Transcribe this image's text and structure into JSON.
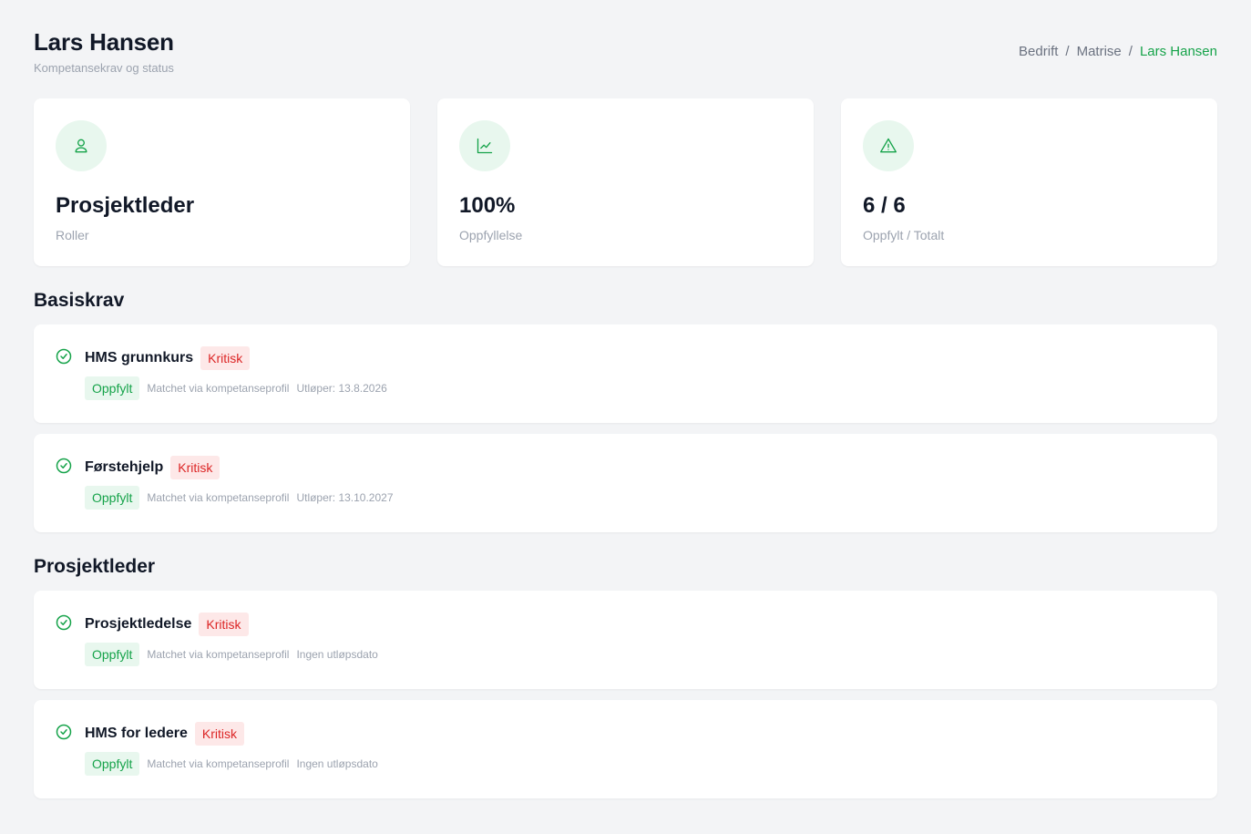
{
  "header": {
    "title": "Lars Hansen",
    "subtitle": "Kompetansekrav og status",
    "breadcrumb": [
      "Bedrift",
      "Matrise",
      "Lars Hansen"
    ],
    "breadcrumb_separator": "/"
  },
  "stats": [
    {
      "icon": "user-icon",
      "value": "Prosjektleder",
      "label": "Roller"
    },
    {
      "icon": "chart-line-icon",
      "value": "100%",
      "label": "Oppfyllelse"
    },
    {
      "icon": "warning-triangle-icon",
      "value": "6 / 6",
      "label": "Oppfylt / Totalt"
    }
  ],
  "sections": [
    {
      "title": "Basiskrav",
      "items": [
        {
          "name": "HMS grunnkurs",
          "severity": "Kritisk",
          "status": "Oppfylt",
          "match": "Matchet via kompetanseprofil",
          "expiry": "Utløper: 13.8.2026"
        },
        {
          "name": "Førstehjelp",
          "severity": "Kritisk",
          "status": "Oppfylt",
          "match": "Matchet via kompetanseprofil",
          "expiry": "Utløper: 13.10.2027"
        }
      ]
    },
    {
      "title": "Prosjektleder",
      "items": [
        {
          "name": "Prosjektledelse",
          "severity": "Kritisk",
          "status": "Oppfylt",
          "match": "Matchet via kompetanseprofil",
          "expiry": "Ingen utløpsdato"
        },
        {
          "name": "HMS for ledere",
          "severity": "Kritisk",
          "status": "Oppfylt",
          "match": "Matchet via kompetanseprofil",
          "expiry": "Ingen utløpsdato"
        }
      ]
    }
  ],
  "colors": {
    "accent": "#16a34a",
    "accent_bg": "#e8f7ee",
    "critical": "#dc2626",
    "critical_bg": "#fde8e8",
    "background": "#f3f4f6"
  }
}
